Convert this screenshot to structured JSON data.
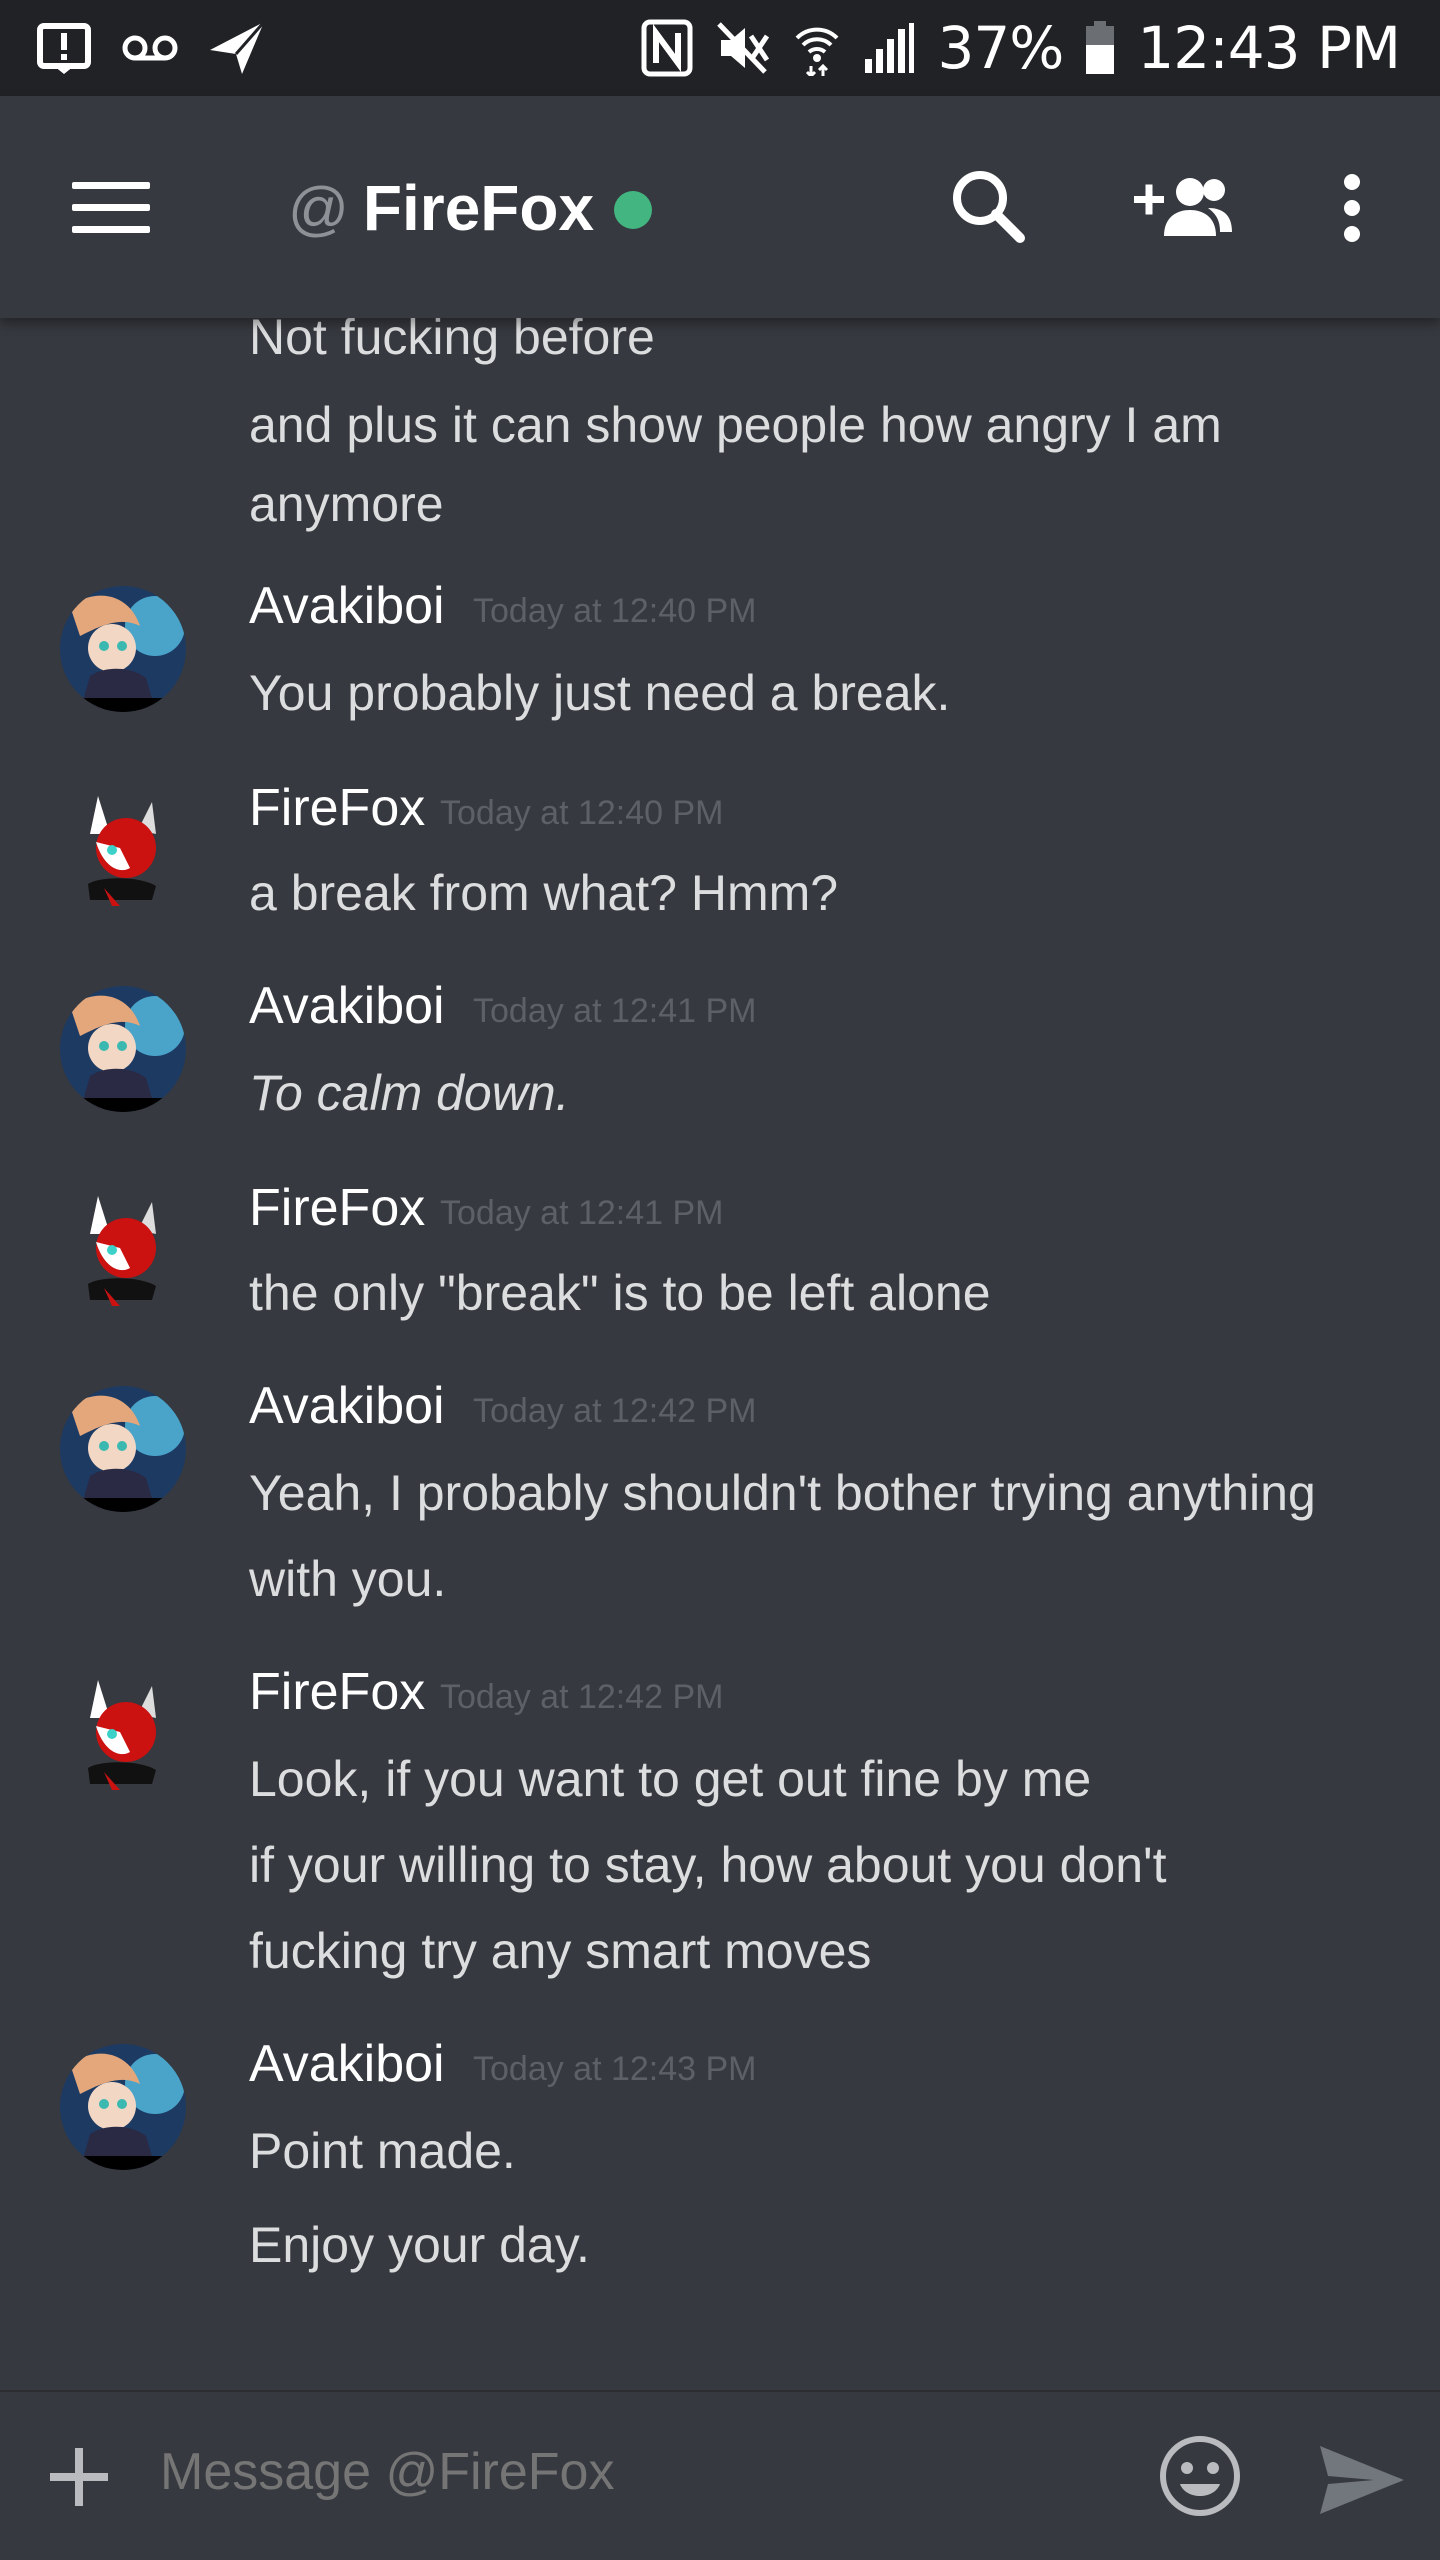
{
  "status_bar": {
    "battery": "37%",
    "time": "12:43 PM",
    "icons_left": [
      "alert-icon",
      "voicemail-icon",
      "send-icon"
    ],
    "icons_right": [
      "nfc-icon",
      "mute-icon",
      "wifi-icon",
      "signal-icon",
      "battery-icon"
    ]
  },
  "header": {
    "at_symbol": "@",
    "channel_name": "FireFox",
    "status_color": "#43b581",
    "icons": [
      "menu-icon",
      "search-icon",
      "add-friend-icon",
      "more-vert-icon"
    ]
  },
  "messages": [
    {
      "continuation": true,
      "lines": [
        "Not fucking before",
        "and plus it can show people how angry I am",
        "anymore"
      ]
    },
    {
      "author": "Avakiboi",
      "timestamp": "Today at 12:40 PM",
      "lines": [
        "You probably just need a break."
      ]
    },
    {
      "author": "FireFox",
      "timestamp": "Today at 12:40 PM",
      "lines": [
        "a break from what? Hmm?"
      ]
    },
    {
      "author": "Avakiboi",
      "timestamp": "Today at 12:41 PM",
      "lines": [
        "To calm down."
      ],
      "italic": true
    },
    {
      "author": "FireFox",
      "timestamp": "Today at 12:41 PM",
      "lines": [
        "the only \"break\" is to be left alone"
      ]
    },
    {
      "author": "Avakiboi",
      "timestamp": "Today at 12:42 PM",
      "lines": [
        "Yeah, I probably shouldn't bother trying anything",
        "with you."
      ]
    },
    {
      "author": "FireFox",
      "timestamp": "Today at 12:42 PM",
      "lines": [
        "Look, if you want to get out fine by me",
        "if your willing to stay, how about you don't",
        "fucking try any smart moves"
      ]
    },
    {
      "author": "Avakiboi",
      "timestamp": "Today at 12:43 PM",
      "lines": [
        "Point made.",
        "Enjoy your day."
      ]
    }
  ],
  "composer": {
    "placeholder": "Message @FireFox",
    "icons": [
      "plus-icon",
      "emoji-icon",
      "send-message-icon"
    ]
  },
  "colors": {
    "background": "#36393f",
    "status_bar": "#202225",
    "online": "#43b581",
    "timestamp": "#5d6066",
    "text": "#dcddde"
  }
}
